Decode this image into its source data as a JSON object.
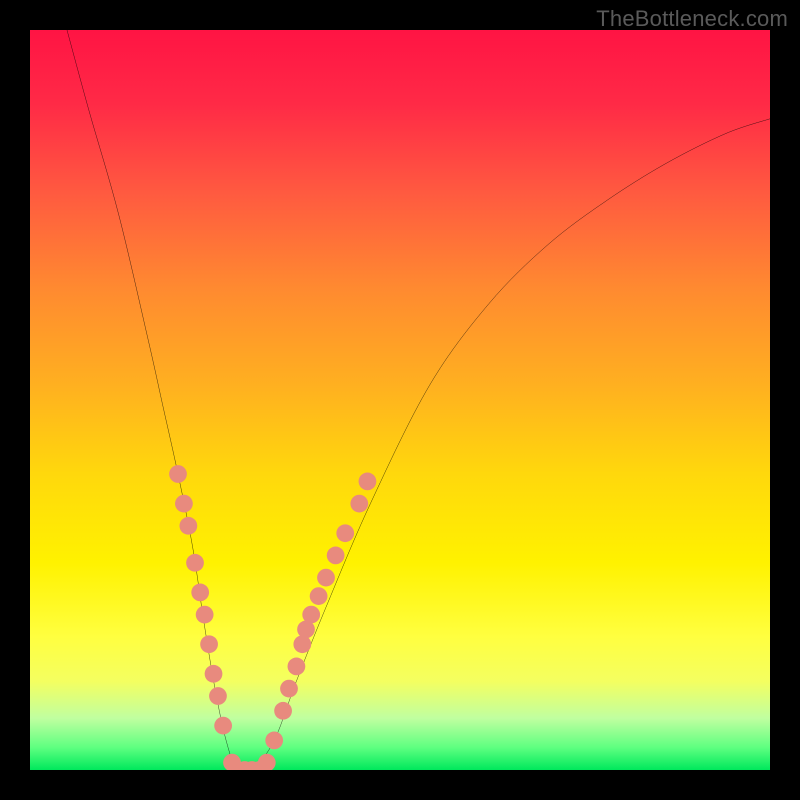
{
  "watermark": "TheBottleneck.com",
  "chart_data": {
    "type": "line",
    "title": "",
    "xlabel": "",
    "ylabel": "",
    "xlim": [
      0,
      100
    ],
    "ylim": [
      0,
      100
    ],
    "grid": false,
    "legend": false,
    "series": [
      {
        "name": "bottleneck-curve",
        "color": "#000000",
        "x": [
          5,
          8,
          12,
          16,
          18,
          20,
          22,
          23.5,
          25,
          26.5,
          28,
          30,
          33,
          36,
          40,
          46,
          54,
          62,
          70,
          78,
          86,
          94,
          100
        ],
        "y": [
          100,
          89,
          75,
          58,
          49,
          40,
          30,
          20,
          11,
          4,
          0,
          0,
          4,
          12,
          22,
          36,
          52,
          63,
          71,
          77,
          82,
          86,
          88
        ]
      }
    ],
    "markers": {
      "name": "dots",
      "color": "#e88a7e",
      "radius": 1.2,
      "points": [
        {
          "x": 20.0,
          "y": 40.0
        },
        {
          "x": 20.8,
          "y": 36.0
        },
        {
          "x": 21.4,
          "y": 33.0
        },
        {
          "x": 22.3,
          "y": 28.0
        },
        {
          "x": 23.0,
          "y": 24.0
        },
        {
          "x": 23.6,
          "y": 21.0
        },
        {
          "x": 24.2,
          "y": 17.0
        },
        {
          "x": 24.8,
          "y": 13.0
        },
        {
          "x": 25.4,
          "y": 10.0
        },
        {
          "x": 26.1,
          "y": 6.0
        },
        {
          "x": 27.3,
          "y": 1.0
        },
        {
          "x": 28.0,
          "y": 0.0
        },
        {
          "x": 29.0,
          "y": 0.0
        },
        {
          "x": 30.0,
          "y": 0.0
        },
        {
          "x": 31.0,
          "y": 0.0
        },
        {
          "x": 32.0,
          "y": 1.0
        },
        {
          "x": 33.0,
          "y": 4.0
        },
        {
          "x": 34.2,
          "y": 8.0
        },
        {
          "x": 35.0,
          "y": 11.0
        },
        {
          "x": 36.0,
          "y": 14.0
        },
        {
          "x": 36.8,
          "y": 17.0
        },
        {
          "x": 37.3,
          "y": 19.0
        },
        {
          "x": 38.0,
          "y": 21.0
        },
        {
          "x": 39.0,
          "y": 23.5
        },
        {
          "x": 40.0,
          "y": 26.0
        },
        {
          "x": 41.3,
          "y": 29.0
        },
        {
          "x": 42.6,
          "y": 32.0
        },
        {
          "x": 44.5,
          "y": 36.0
        },
        {
          "x": 45.6,
          "y": 39.0
        }
      ]
    }
  }
}
